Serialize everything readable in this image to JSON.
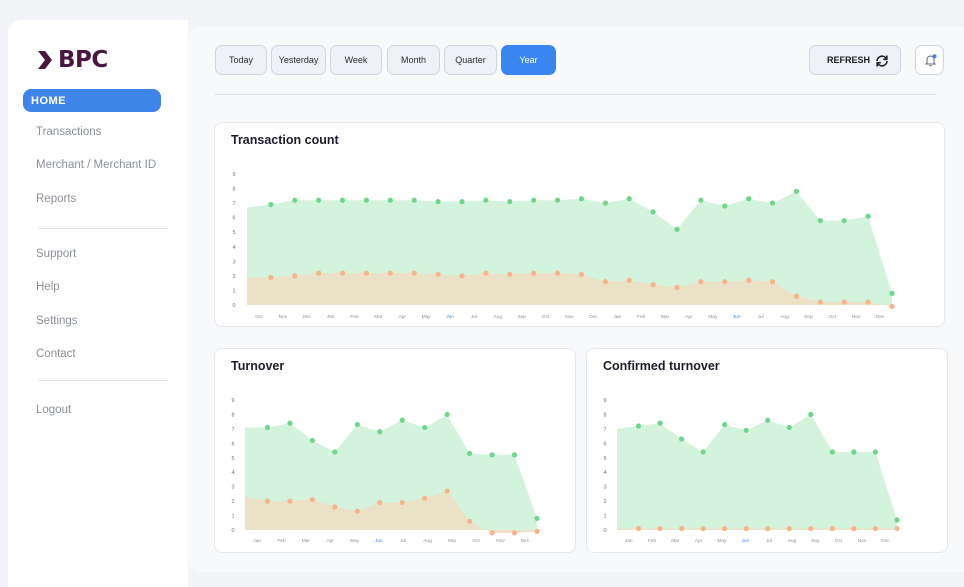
{
  "brand": {
    "name": "BPC",
    "color": "#4a1640"
  },
  "sidebar": {
    "items": [
      {
        "label": "HOME",
        "active": true
      },
      {
        "label": "Transactions"
      },
      {
        "label": "Merchant / Merchant ID"
      },
      {
        "label": "Reports"
      },
      {
        "label": "Support"
      },
      {
        "label": "Help"
      },
      {
        "label": "Settings"
      },
      {
        "label": "Contact"
      },
      {
        "label": "Logout"
      }
    ]
  },
  "toolbar": {
    "periods": [
      "Today",
      "Yesterday",
      "Week",
      "Month",
      "Quarter",
      "Year"
    ],
    "selected_period": "Year",
    "refresh_label": "REFRESH",
    "refresh_icon": "refresh-icon",
    "notification_icon": "bell-icon",
    "accent_color": "#3a86f0"
  },
  "colors": {
    "green_line": "#6fd58b",
    "green_fill": "#d4f3dc",
    "orange_dot": "#f7b48a",
    "orange_fill": "#ecdfc4"
  },
  "chart_data": [
    {
      "title": "Transaction count",
      "type": "area",
      "ylim": [
        0,
        9
      ],
      "y_ticks": [
        "0",
        "1",
        "2",
        "3",
        "4",
        "5",
        "6",
        "7",
        "8",
        "9"
      ],
      "categories": [
        "Oct",
        "Nov",
        "Dec",
        "Jan",
        "Feb",
        "Mar",
        "Apr",
        "May",
        "Jun",
        "Jul",
        "Aug",
        "Sep",
        "Oct",
        "Nov",
        "Dec",
        "Jan",
        "Feb",
        "Mar",
        "Apr",
        "May",
        "Jun",
        "Jul",
        "Aug",
        "Sep",
        "Oct",
        "Nov",
        "Dec"
      ],
      "highlight_categories": [
        8,
        20
      ],
      "series": [
        {
          "values": [
            6.7,
            6.9,
            7.2,
            7.2,
            7.2,
            7.2,
            7.2,
            7.2,
            7.1,
            7.1,
            7.2,
            7.1,
            7.2,
            7.2,
            7.3,
            7.0,
            7.3,
            6.4,
            5.2,
            7.2,
            6.8,
            7.3,
            7.0,
            7.8,
            5.8,
            5.8,
            6.1,
            0.8
          ],
          "color": "#6fd58b"
        },
        {
          "values": [
            1.9,
            1.9,
            2.0,
            2.2,
            2.2,
            2.2,
            2.2,
            2.2,
            2.1,
            2.0,
            2.2,
            2.1,
            2.2,
            2.2,
            2.1,
            1.6,
            1.7,
            1.4,
            1.2,
            1.6,
            1.6,
            1.7,
            1.6,
            0.6,
            0.2,
            0.2,
            0.2,
            -0.1
          ],
          "color": "#f7b48a"
        }
      ]
    },
    {
      "title": "Turnover",
      "type": "area",
      "ylim": [
        0,
        9
      ],
      "y_ticks": [
        "0",
        "1",
        "2",
        "3",
        "4",
        "5",
        "6",
        "7",
        "8",
        "9"
      ],
      "categories": [
        "Jan",
        "Feb",
        "Mar",
        "Apr",
        "May",
        "Jun",
        "Jul",
        "Aug",
        "Sep",
        "Oct",
        "Nov",
        "Dec"
      ],
      "highlight_categories": [
        5
      ],
      "series": [
        {
          "values": [
            7.1,
            7.1,
            7.4,
            6.2,
            5.4,
            7.3,
            6.8,
            7.6,
            7.1,
            8.0,
            5.3,
            5.2,
            5.2,
            0.8
          ],
          "color": "#6fd58b"
        },
        {
          "values": [
            2.3,
            2.0,
            2.0,
            2.1,
            1.6,
            1.3,
            1.9,
            1.9,
            2.2,
            2.7,
            0.6,
            -0.2,
            -0.2,
            -0.1
          ],
          "color": "#f7b48a"
        }
      ]
    },
    {
      "title": "Confirmed turnover",
      "type": "area",
      "ylim": [
        0,
        9
      ],
      "y_ticks": [
        "0",
        "1",
        "2",
        "3",
        "4",
        "5",
        "6",
        "7",
        "8",
        "9"
      ],
      "categories": [
        "Jan",
        "Feb",
        "Mar",
        "Apr",
        "May",
        "Jun",
        "Jul",
        "Aug",
        "Sep",
        "Oct",
        "Nov",
        "Dec"
      ],
      "highlight_categories": [
        5
      ],
      "series": [
        {
          "values": [
            7.0,
            7.2,
            7.4,
            6.3,
            5.4,
            7.3,
            6.9,
            7.6,
            7.1,
            8.0,
            5.4,
            5.4,
            5.4,
            0.7
          ],
          "color": "#6fd58b"
        },
        {
          "values": [
            0.1,
            0.1,
            0.1,
            0.1,
            0.1,
            0.1,
            0.1,
            0.1,
            0.1,
            0.1,
            0.1,
            0.1,
            0.1,
            0.1
          ],
          "color": "#f7b48a"
        }
      ]
    }
  ]
}
